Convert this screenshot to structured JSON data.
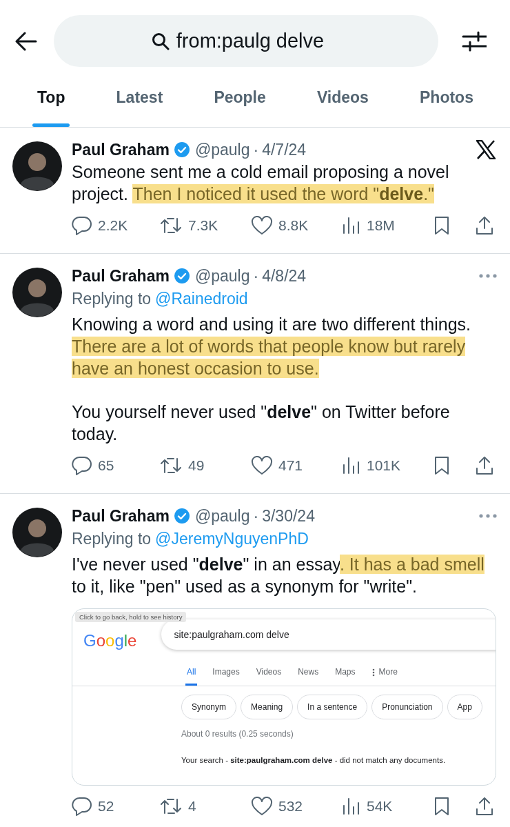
{
  "search": {
    "value": "from:paulg delve"
  },
  "tabs": [
    {
      "label": "Top",
      "selected": true
    },
    {
      "label": "Latest",
      "selected": false
    },
    {
      "label": "People",
      "selected": false
    },
    {
      "label": "Videos",
      "selected": false
    },
    {
      "label": "Photos",
      "selected": false
    }
  ],
  "tweets": [
    {
      "name": "Paul Graham",
      "verified": true,
      "handle": "@paulg",
      "dot": "·",
      "date": "4/7/24",
      "x_logo": true,
      "paragraphs": [
        [
          {
            "text": "Someone sent me a cold email proposing a novel project. ",
            "highlighted": false
          },
          {
            "text": "Then I noticed it used the word \"**delve**.\"",
            "highlighted": true
          }
        ]
      ],
      "stats": {
        "replies": "2.2K",
        "reposts": "7.3K",
        "likes": "8.8K",
        "views": "18M"
      }
    },
    {
      "name": "Paul Graham",
      "verified": true,
      "handle": "@paulg",
      "dot": "·",
      "date": "4/8/24",
      "more_menu": true,
      "reply_label": "Replying to",
      "reply_to": "@Rainedroid",
      "paragraphs": [
        [
          {
            "text": "Knowing a word and using it are two different things. ",
            "highlighted": false
          },
          {
            "text": "There are a lot of words that people know but rarely have an honest occasion to use.",
            "highlighted": true
          }
        ],
        [
          {
            "text": "You yourself never used \"**delve**\" on Twitter before today.",
            "highlighted": false
          }
        ]
      ],
      "stats": {
        "replies": "65",
        "reposts": "49",
        "likes": "471",
        "views": "101K"
      }
    },
    {
      "name": "Paul Graham",
      "verified": true,
      "handle": "@paulg",
      "dot": "·",
      "date": "3/30/24",
      "more_menu": true,
      "reply_label": "Replying to",
      "reply_to": "@JeremyNguyenPhD",
      "paragraphs": [
        [
          {
            "text": "I've never used \"**delve**\" in an essay",
            "highlighted": false
          },
          {
            "text": ". It has a bad smell",
            "highlighted": true
          },
          {
            "text": " to it, like \"pen\" used as a synonym for \"write\".",
            "highlighted": false
          }
        ]
      ],
      "card": {
        "tooltip": "Click to go back, hold to see history",
        "logo": "Google",
        "query": "site:paulgraham.com delve",
        "tabs": [
          {
            "label": "All",
            "selected": true,
            "kind": "plain"
          },
          {
            "label": "Images",
            "selected": false,
            "kind": "plain"
          },
          {
            "label": "Videos",
            "selected": false,
            "kind": "plain"
          },
          {
            "label": "News",
            "selected": false,
            "kind": "plain"
          },
          {
            "label": "Maps",
            "selected": false,
            "kind": "plain"
          },
          {
            "label": "More",
            "selected": false,
            "kind": "menu"
          }
        ],
        "chips": [
          "Synonym",
          "Meaning",
          "In a sentence",
          "Pronunciation",
          "App"
        ],
        "result_stats": "About 0 results (0.25 seconds)",
        "message": "Your search - **site:paulgraham.com delve** - did not match any documents."
      },
      "stats": {
        "replies": "52",
        "reposts": "4",
        "likes": "532",
        "views": "54K"
      }
    }
  ]
}
